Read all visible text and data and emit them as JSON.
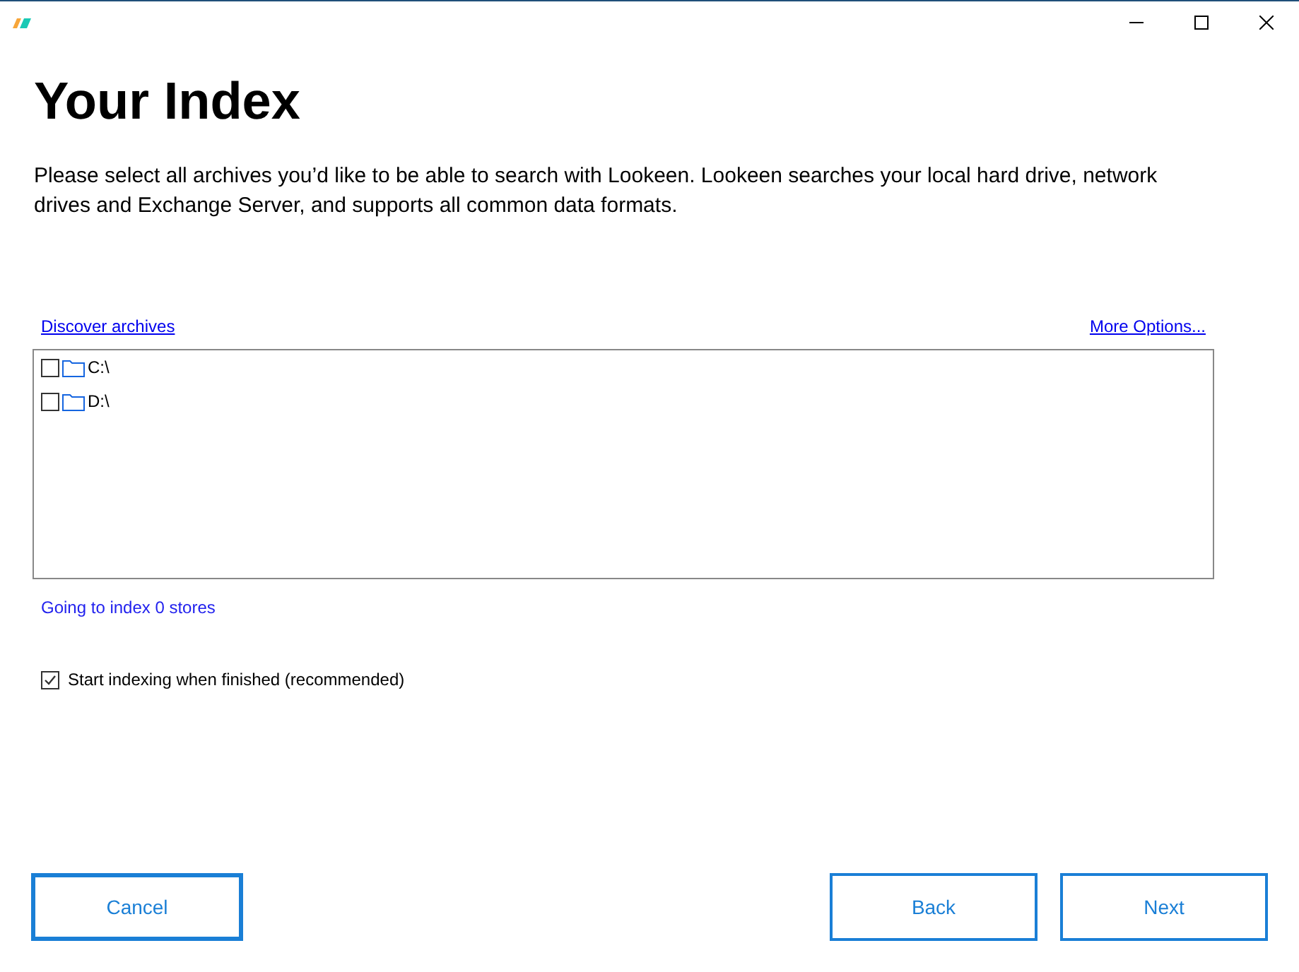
{
  "title": "Your Index",
  "description": "Please select all archives you’d like to be able to search with Lookeen. Lookeen searches your local hard drive, network drives and Exchange Server, and supports all common data formats.",
  "discover_link": "Discover archives",
  "options_link": "More Options...",
  "archives": [
    {
      "label": "C:\\",
      "checked": false
    },
    {
      "label": "D:\\",
      "checked": false
    }
  ],
  "status": "Going to index 0 stores",
  "start_indexing": {
    "label": "Start indexing when finished (recommended)",
    "checked": true
  },
  "buttons": {
    "cancel": "Cancel",
    "back": "Back",
    "next": "Next"
  }
}
